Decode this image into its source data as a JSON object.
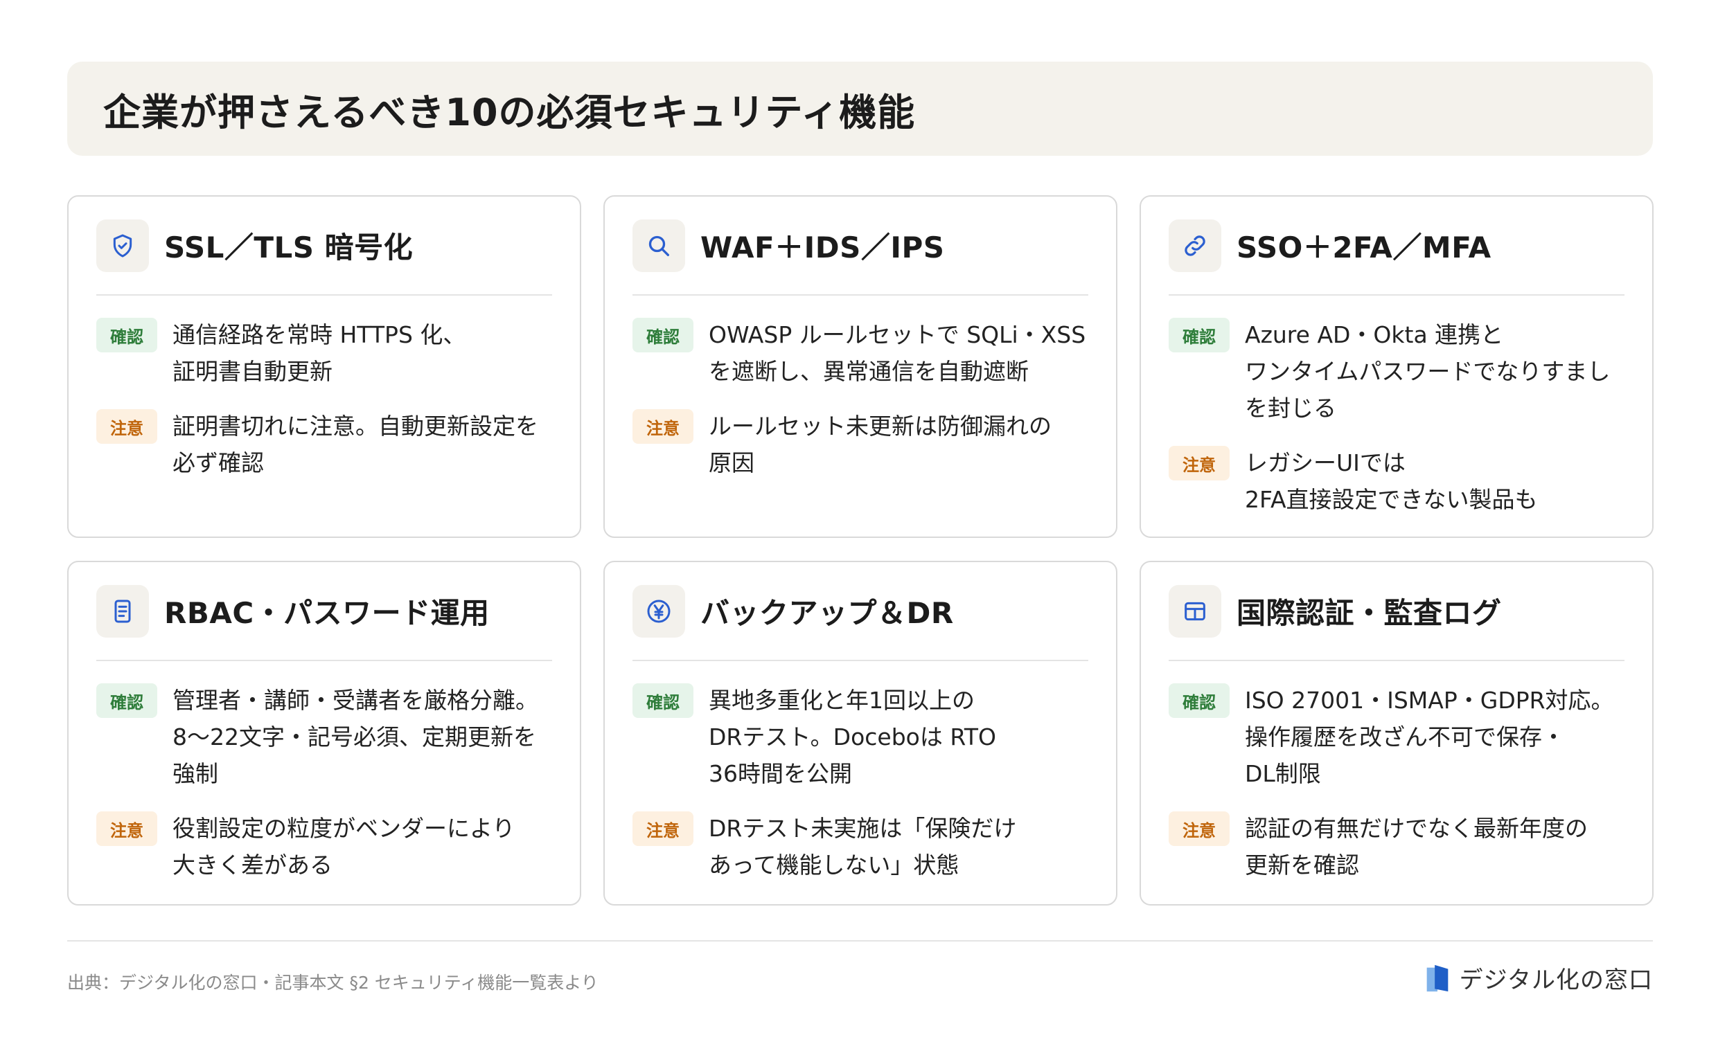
{
  "title": "企業が押さえるべき10の必須セキュリティ機能",
  "badges": {
    "confirm": "確認",
    "caution": "注意"
  },
  "colors": {
    "icon_blue": "#2b5fd0",
    "confirm_green": "#2e7d3a",
    "caution_orange": "#c0650b"
  },
  "cards": [
    {
      "icon": "shield-icon",
      "title": "SSL／TLS 暗号化",
      "confirm": "通信経路を常時 HTTPS 化、\n証明書自動更新",
      "caution": "証明書切れに注意。自動更新設定を\n必ず確認"
    },
    {
      "icon": "search-icon",
      "title": "WAF＋IDS／IPS",
      "confirm": "OWASP ルールセットで SQLi・XSS\nを遮断し、異常通信を自動遮断",
      "caution": "ルールセット未更新は防御漏れの\n原因"
    },
    {
      "icon": "link-icon",
      "title": "SSO＋2FA／MFA",
      "confirm": "Azure AD・Okta 連携と\nワンタイムパスワードでなりすまし\nを封じる",
      "caution": "レガシーUIでは\n2FA直接設定できない製品も"
    },
    {
      "icon": "document-icon",
      "title": "RBAC・パスワード運用",
      "confirm": "管理者・講師・受講者を厳格分離。\n8〜22文字・記号必須、定期更新を\n強制",
      "caution": "役割設定の粒度がベンダーにより\n大きく差がある"
    },
    {
      "icon": "yen-icon",
      "title": "バックアップ＆DR",
      "confirm": "異地多重化と年1回以上の\nDRテスト。Doceboは RTO\n36時間を公開",
      "caution": "DRテスト未実施は「保険だけ\nあって機能しない」状態"
    },
    {
      "icon": "grid-icon",
      "title": "国際認証・監査ログ",
      "confirm": "ISO 27001・ISMAP・GDPR対応。\n操作履歴を改ざん不可で保存・\nDL制限",
      "caution": "認証の有無だけでなく最新年度の\n更新を確認"
    }
  ],
  "footer": {
    "source": "出典：デジタル化の窓口・記事本文 §2 セキュリティ機能一覧表より",
    "brand": "デジタル化の窓口"
  }
}
